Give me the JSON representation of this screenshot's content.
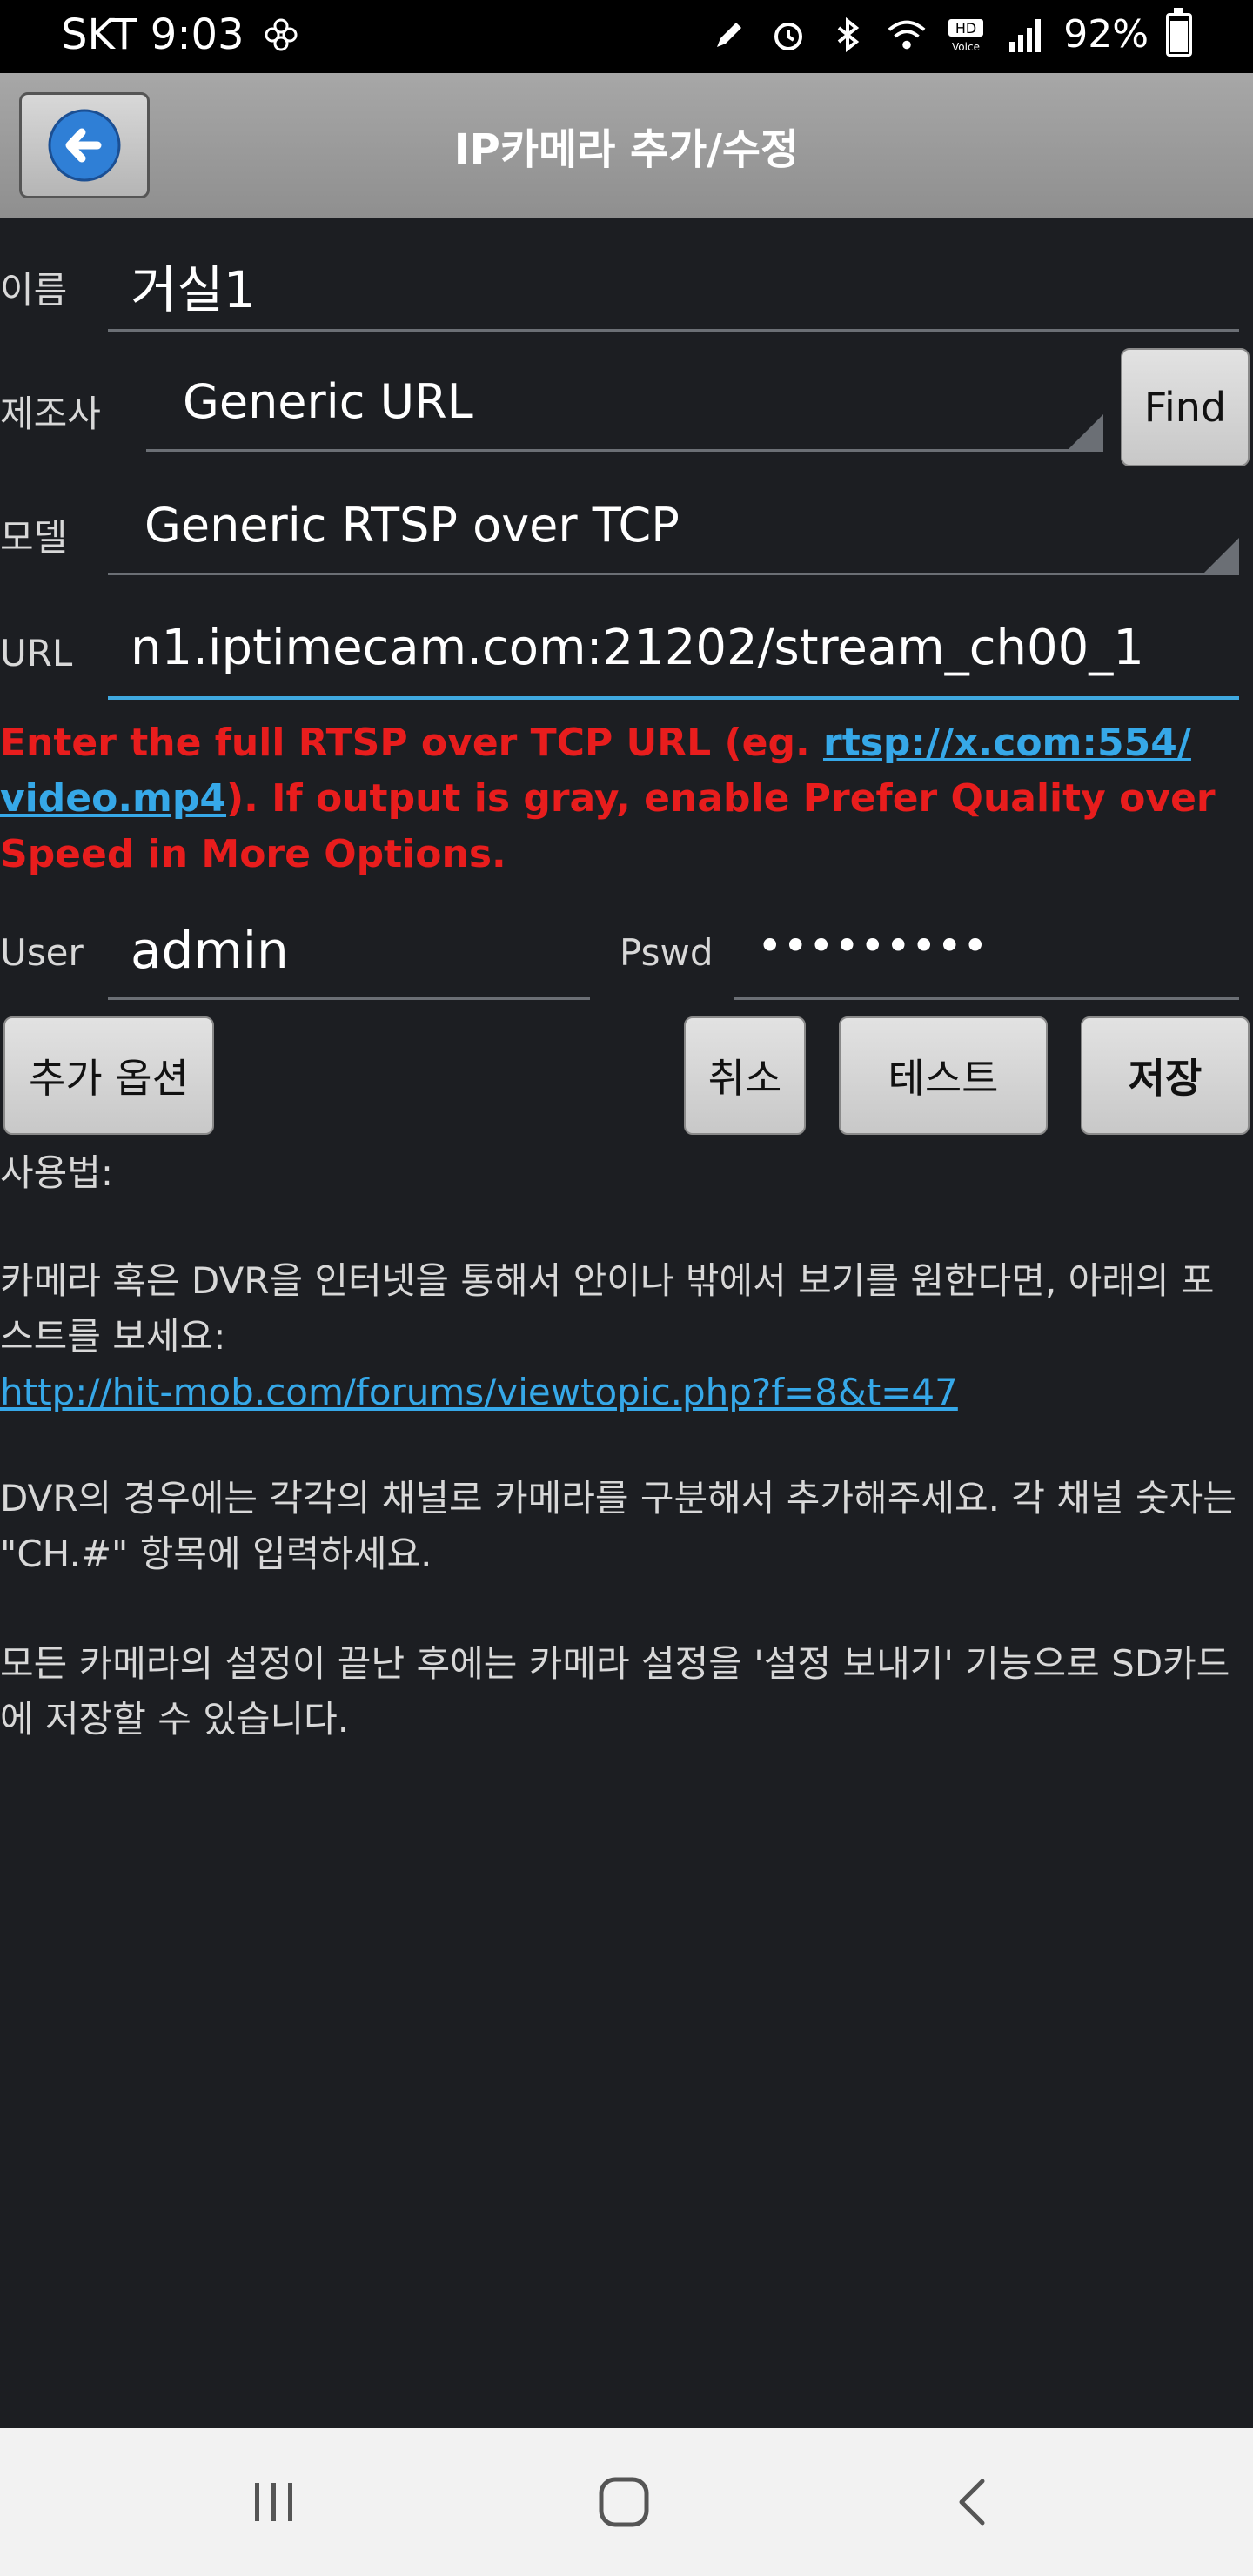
{
  "status": {
    "carrier_time": "SKT 9:03",
    "battery": "92%"
  },
  "header": {
    "title": "IP카메라 추가/수정"
  },
  "form": {
    "name_label": "이름",
    "name_value": "거실1",
    "maker_label": "제조사",
    "maker_value": "Generic URL",
    "find_label": "Find",
    "model_label": "모델",
    "model_value": "Generic RTSP over TCP",
    "url_label": "URL",
    "url_value": "n1.iptimecam.com:21202/stream_ch00_1",
    "hint_part1": "Enter the full RTSP over TCP URL (eg. ",
    "hint_link": "rtsp://x.com:554/ video.mp4",
    "hint_part2": "). If output is gray, enable Prefer Quality over Speed in More Options.",
    "user_label": "User",
    "user_value": "admin",
    "pswd_label": "Pswd",
    "pswd_value": "•••••••••"
  },
  "buttons": {
    "more_options": "추가 옵션",
    "cancel": "취소",
    "test": "테스트",
    "save": "저장"
  },
  "help": {
    "heading": "사용법:",
    "para1": "카메라 혹은 DVR을 인터넷을 통해서 안이나 밖에서 보기를 원한다면, 아래의 포스트를 보세요:",
    "link": "http://hit-mob.com/forums/viewtopic.php?f=8&t=47",
    "para2": "DVR의 경우에는 각각의 채널로 카메라를 구분해서 추가해주세요. 각 채널 숫자는 \"CH.#\" 항목에 입력하세요.",
    "para3": "모든 카메라의 설정이 끝난 후에는 카메라 설정을 '설정 보내기' 기능으로 SD카드에 저장할 수 있습니다."
  },
  "colors": {
    "accent": "#3fa9e0",
    "warning": "#e81d1d",
    "link": "#36a8e8",
    "background": "#1c1e22"
  },
  "icons": [
    "back-arrow-icon",
    "recents-icon",
    "home-icon",
    "nav-back-icon"
  ]
}
